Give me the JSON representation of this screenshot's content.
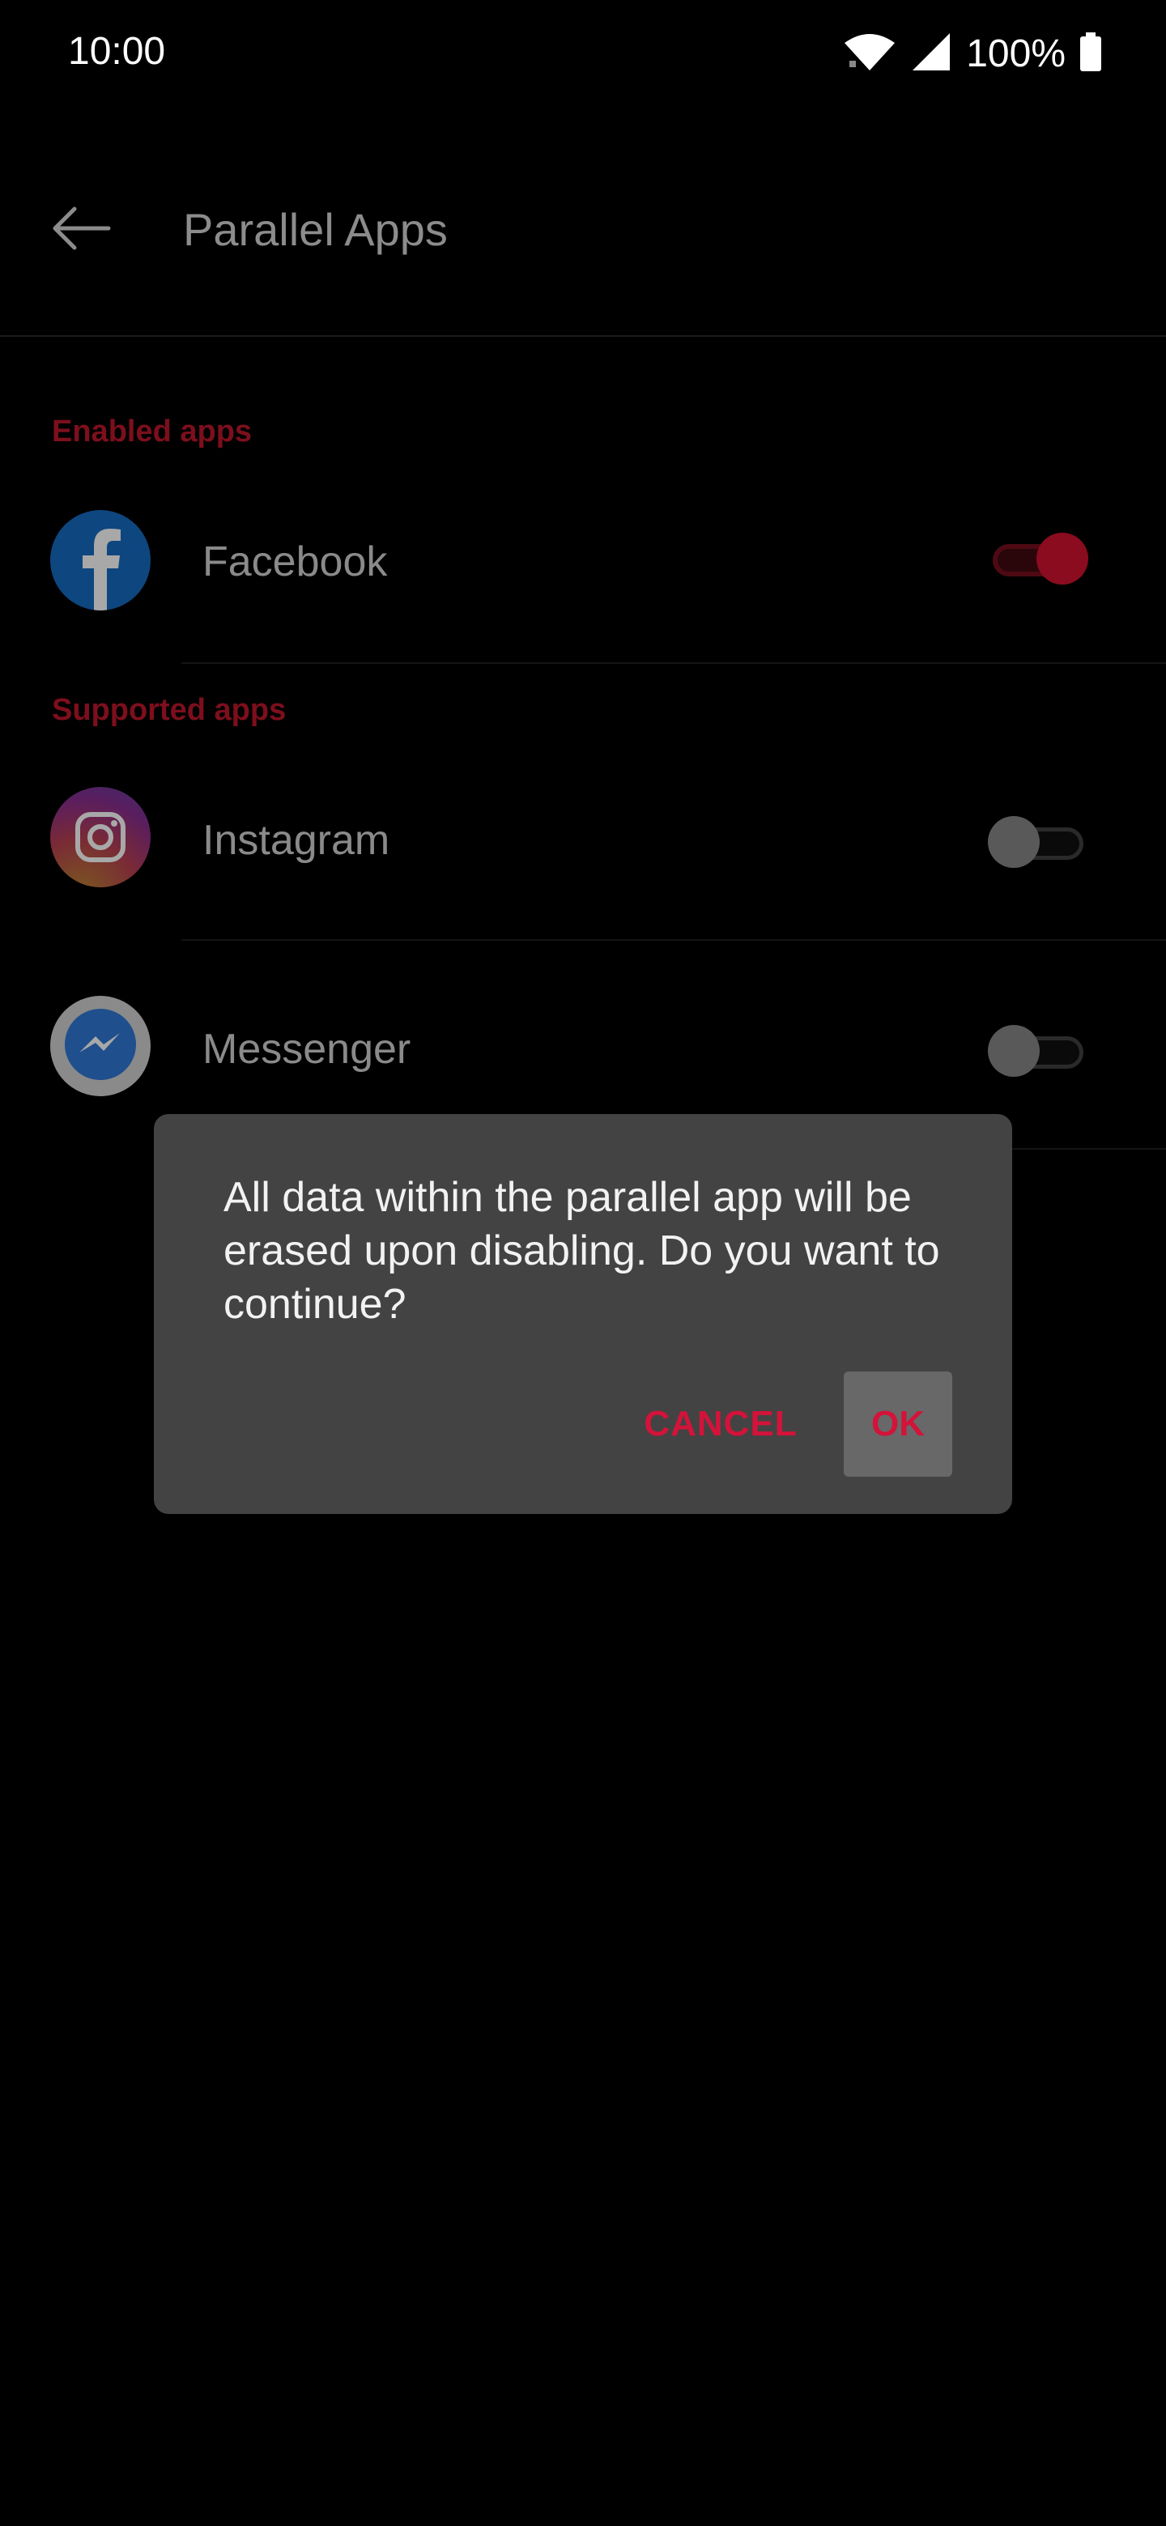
{
  "status_bar": {
    "time": "10:00",
    "battery": "100%",
    "icons": [
      "wifi-icon",
      "cell-signal-icon",
      "battery-icon"
    ]
  },
  "app_bar": {
    "title": "Parallel Apps",
    "back_icon": "arrow-left-icon"
  },
  "sections": [
    {
      "header": "Enabled apps",
      "items": [
        {
          "label": "Facebook",
          "icon": "facebook-icon",
          "toggle_on": true
        }
      ]
    },
    {
      "header": "Supported apps",
      "items": [
        {
          "label": "Instagram",
          "icon": "instagram-icon",
          "toggle_on": false
        },
        {
          "label": "Messenger",
          "icon": "messenger-icon",
          "toggle_on": false
        }
      ]
    }
  ],
  "dialog": {
    "message": "All data within the parallel app will be erased upon disabling. Do you want to continue?",
    "cancel_label": "CANCEL",
    "ok_label": "OK"
  },
  "colors": {
    "accent": "#d4133a",
    "dialog_bg": "#434343",
    "background": "#000000"
  }
}
